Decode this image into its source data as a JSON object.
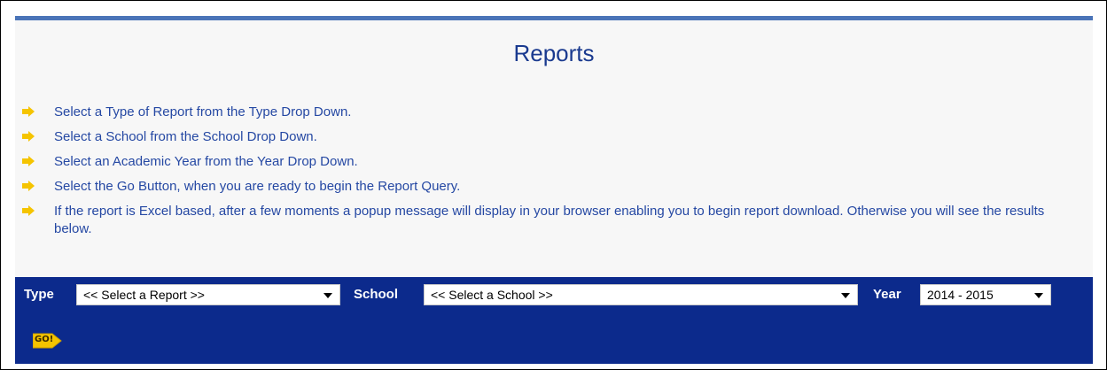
{
  "page": {
    "title": "Reports"
  },
  "instructions": [
    "Select a Type of Report from the Type Drop Down.",
    "Select a School from the School Drop Down.",
    "Select an Academic Year from the Year Drop Down.",
    "Select the Go Button, when you are ready to begin the Report Query.",
    "If the report is Excel based, after a few moments a popup message will display in your browser enabling you to begin report download. Otherwise you will see the results below."
  ],
  "filters": {
    "type_label": "Type",
    "type_value": "<< Select a Report >>",
    "school_label": "School",
    "school_value": "<< Select a School >>",
    "year_label": "Year",
    "year_value": "2014 - 2015"
  },
  "go_button": {
    "label": "GO!",
    "icon": "go-arrow-icon"
  },
  "colors": {
    "accent_bar": "#4a74b8",
    "toolbar_bg": "#0c2a8c",
    "text_blue": "#2548a3",
    "title_blue": "#1a3a8f",
    "bullet_yellow": "#f5c400",
    "panel_bg": "#f7f7f7"
  }
}
